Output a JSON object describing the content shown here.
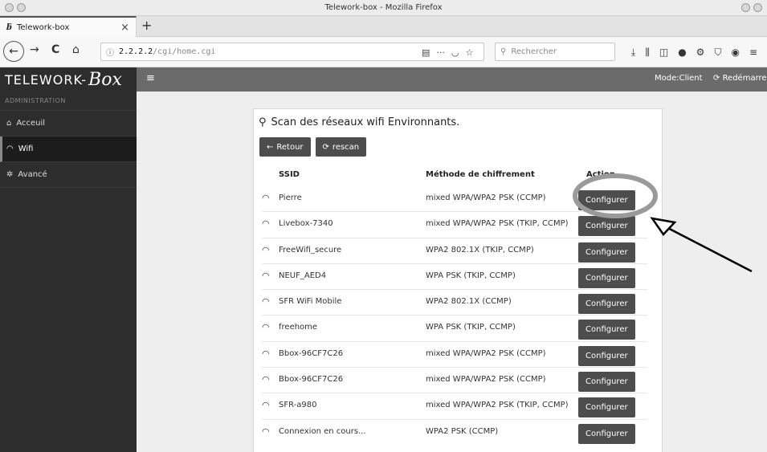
{
  "window": {
    "title": "Telework-box - Mozilla Firefox"
  },
  "tab": {
    "title": "Telework-box",
    "close": "×",
    "new_tab": "+"
  },
  "nav": {
    "back": "←",
    "forward": "→",
    "reload": "C",
    "home": "⌂",
    "url_info": "ⓘ",
    "url_host": "2.2.2.2",
    "url_path": "/cgi/home.cgi",
    "search_placeholder": "Rechercher"
  },
  "header": {
    "brand_text": "TELEWORK-",
    "brand_box": "Box",
    "menu": "≡",
    "mode": "Mode:Client",
    "restart": "Redémarrer"
  },
  "sidebar": {
    "section": "ADMINISTRATION",
    "items": [
      {
        "label": "Acceuil"
      },
      {
        "label": "Wifi"
      },
      {
        "label": "Avancé"
      }
    ]
  },
  "panel": {
    "title": "Scan des réseaux wifi Environnants.",
    "back_label": "Retour",
    "rescan_label": "rescan",
    "columns": {
      "ssid": "SSID",
      "encryption": "Méthode de chiffrement",
      "action": "Action"
    },
    "rows": [
      {
        "ssid": "Pierre",
        "enc": "mixed WPA/WPA2 PSK (CCMP)",
        "action": "Configurer"
      },
      {
        "ssid": "Livebox-7340",
        "enc": "mixed WPA/WPA2 PSK (TKIP, CCMP)",
        "action": "Configurer"
      },
      {
        "ssid": "FreeWifi_secure",
        "enc": "WPA2 802.1X (TKIP, CCMP)",
        "action": "Configurer"
      },
      {
        "ssid": "NEUF_AED4",
        "enc": "WPA PSK (TKIP, CCMP)",
        "action": "Configurer"
      },
      {
        "ssid": "SFR WiFi Mobile",
        "enc": "WPA2 802.1X (CCMP)",
        "action": "Configurer"
      },
      {
        "ssid": "freehome",
        "enc": "WPA PSK (TKIP, CCMP)",
        "action": "Configurer"
      },
      {
        "ssid": "Bbox-96CF7C26",
        "enc": "mixed WPA/WPA2 PSK (CCMP)",
        "action": "Configurer"
      },
      {
        "ssid": "Bbox-96CF7C26",
        "enc": "mixed WPA/WPA2 PSK (CCMP)",
        "action": "Configurer"
      },
      {
        "ssid": "SFR-a980",
        "enc": "mixed WPA/WPA2 PSK (TKIP, CCMP)",
        "action": "Configurer"
      },
      {
        "ssid": "Connexion en cours...",
        "enc": "WPA2 PSK (CCMP)",
        "action": "Configurer"
      }
    ]
  }
}
